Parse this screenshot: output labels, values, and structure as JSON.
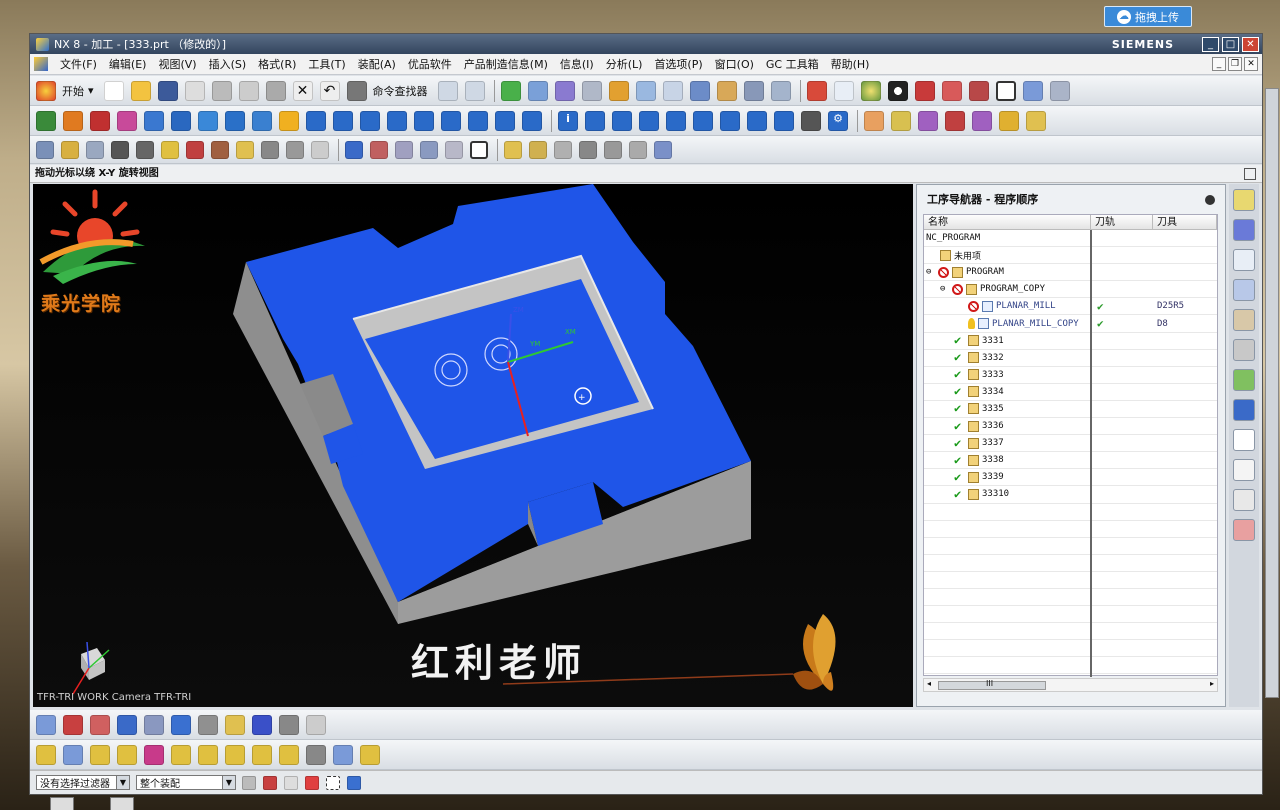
{
  "upload_button": "拖拽上传",
  "window": {
    "title": "NX 8 - 加工 - [333.prt （修改的）]",
    "brand": "SIEMENS",
    "controls": [
      "_",
      "□",
      "✕"
    ]
  },
  "menu": [
    "文件(F)",
    "编辑(E)",
    "视图(V)",
    "插入(S)",
    "格式(R)",
    "工具(T)",
    "装配(A)",
    "优品软件",
    "产品制造信息(M)",
    "信息(I)",
    "分析(L)",
    "首选项(P)",
    "窗口(O)",
    "GC 工具箱",
    "帮助(H)"
  ],
  "toolbar": {
    "start_label": "开始",
    "command_finder_label": "命令查找器"
  },
  "hint_text": "拖动光标以绕 X-Y 旋转视图",
  "viewport": {
    "logo_text": "乘光学院",
    "teacher_text": "红利老师",
    "camera_text": "TFR-TRI WORK Camera TFR-TRI",
    "axis_labels": [
      "XM",
      "YM",
      "ZM"
    ],
    "part_color": "#1f55e8",
    "wall_color": "#9a9a9a"
  },
  "navigator": {
    "title": "工序导航器 - 程序顺序",
    "columns": [
      "名称",
      "刀轨",
      "刀具"
    ],
    "rows": [
      {
        "indent": 0,
        "icon": "",
        "status": "",
        "name": "NC_PROGRAM",
        "toolpath": "",
        "tool": ""
      },
      {
        "indent": 1,
        "icon": "folder",
        "status": "",
        "name": "未用项",
        "toolpath": "",
        "tool": ""
      },
      {
        "indent": 0,
        "expander": "⊖",
        "icon": "folder",
        "status": "no",
        "name": "PROGRAM",
        "toolpath": "",
        "tool": ""
      },
      {
        "indent": 1,
        "expander": "⊖",
        "icon": "folder",
        "status": "no",
        "name": "PROGRAM_COPY",
        "toolpath": "",
        "tool": ""
      },
      {
        "indent": 3,
        "icon": "op",
        "status": "no",
        "name": "PLANAR_MILL",
        "toolpath": "✔",
        "tool": "D25R5"
      },
      {
        "indent": 3,
        "icon": "op",
        "status": "key",
        "name": "PLANAR_MILL_COPY",
        "toolpath": "✔",
        "tool": "D8"
      },
      {
        "indent": 2,
        "icon": "folder",
        "status": "ok",
        "name": "3331",
        "toolpath": "",
        "tool": ""
      },
      {
        "indent": 2,
        "icon": "folder",
        "status": "ok",
        "name": "3332",
        "toolpath": "",
        "tool": ""
      },
      {
        "indent": 2,
        "icon": "folder",
        "status": "ok",
        "name": "3333",
        "toolpath": "",
        "tool": ""
      },
      {
        "indent": 2,
        "icon": "folder",
        "status": "ok",
        "name": "3334",
        "toolpath": "",
        "tool": ""
      },
      {
        "indent": 2,
        "icon": "folder",
        "status": "ok",
        "name": "3335",
        "toolpath": "",
        "tool": ""
      },
      {
        "indent": 2,
        "icon": "folder",
        "status": "ok",
        "name": "3336",
        "toolpath": "",
        "tool": ""
      },
      {
        "indent": 2,
        "icon": "folder",
        "status": "ok",
        "name": "3337",
        "toolpath": "",
        "tool": ""
      },
      {
        "indent": 2,
        "icon": "folder",
        "status": "ok",
        "name": "3338",
        "toolpath": "",
        "tool": ""
      },
      {
        "indent": 2,
        "icon": "folder",
        "status": "ok",
        "name": "3339",
        "toolpath": "",
        "tool": ""
      },
      {
        "indent": 2,
        "icon": "folder",
        "status": "ok",
        "name": "33310",
        "toolpath": "",
        "tool": ""
      }
    ],
    "scroll_label": "III"
  },
  "statusbar": {
    "filter_value": "没有选择过滤器",
    "scope_value": "整个装配"
  }
}
